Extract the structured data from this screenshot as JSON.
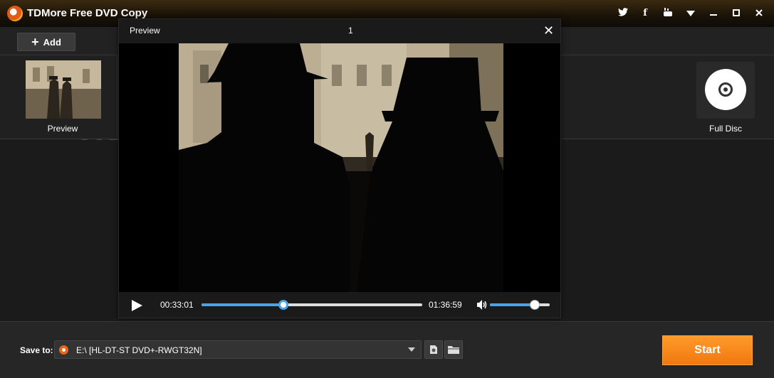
{
  "app": {
    "title": "TDMore Free DVD Copy"
  },
  "titlebar": {
    "icons": [
      "twitter-icon",
      "facebook-icon",
      "youtube-icon",
      "dropdown-icon",
      "minimize-icon",
      "maximize-icon",
      "close-icon"
    ]
  },
  "toolbar": {
    "add_label": "Add"
  },
  "source": {
    "thumb_label": "Preview",
    "watermark": "SOFTPEDIA"
  },
  "mode": {
    "full_disc_label": "Full Disc"
  },
  "preview": {
    "title": "Preview",
    "title_number": "1",
    "current_time": "00:33:01",
    "total_time": "01:36:59",
    "progress_fraction": 0.37,
    "volume_fraction": 0.75
  },
  "output": {
    "save_to_label": "Save to:",
    "save_to_value": "E:\\ [HL-DT-ST DVD+-RWGT32N]",
    "start_label": "Start"
  },
  "colors": {
    "accent": "#f07810",
    "progress": "#4aa3e8"
  }
}
